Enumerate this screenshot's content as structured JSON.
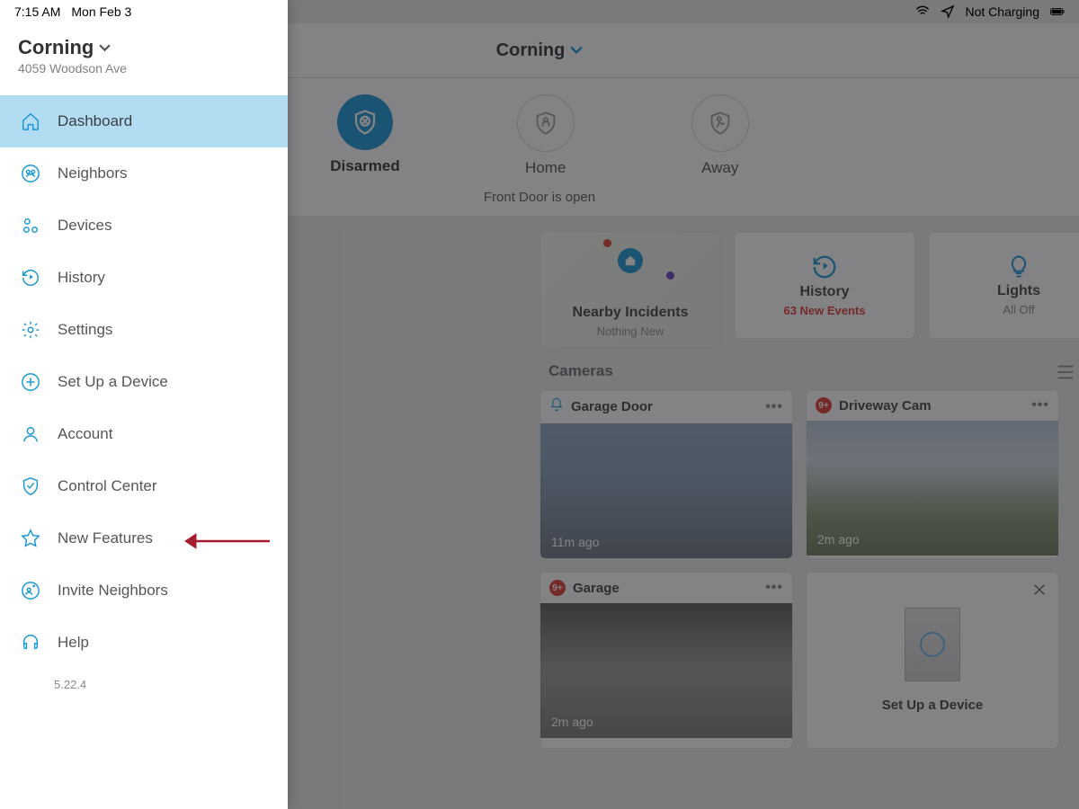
{
  "statusbar": {
    "time": "7:15 AM",
    "date": "Mon Feb 3",
    "charge": "Not Charging"
  },
  "sidebar": {
    "location": "Corning",
    "address": "4059 Woodson Ave",
    "items": [
      {
        "label": "Dashboard",
        "icon": "home-icon"
      },
      {
        "label": "Neighbors",
        "icon": "group-icon"
      },
      {
        "label": "Devices",
        "icon": "devices-icon"
      },
      {
        "label": "History",
        "icon": "history-icon"
      },
      {
        "label": "Settings",
        "icon": "gear-icon"
      },
      {
        "label": "Set Up a Device",
        "icon": "plus-circle-icon"
      },
      {
        "label": "Account",
        "icon": "user-icon"
      },
      {
        "label": "Control Center",
        "icon": "shield-check-icon"
      },
      {
        "label": "New Features",
        "icon": "star-icon"
      },
      {
        "label": "Invite Neighbors",
        "icon": "invite-icon"
      },
      {
        "label": "Help",
        "icon": "headset-icon"
      }
    ],
    "version": "5.22.4"
  },
  "header": {
    "location": "Corning"
  },
  "alarm": {
    "modes": [
      {
        "label": "Disarmed",
        "icon": "disarmed-icon",
        "active": true
      },
      {
        "label": "Home",
        "icon": "home-mode-icon",
        "active": false
      },
      {
        "label": "Away",
        "icon": "away-mode-icon",
        "active": false
      }
    ],
    "status": "Front Door is open"
  },
  "widgets": [
    {
      "title": "Nearby Incidents",
      "sub": "Nothing New",
      "type": "map"
    },
    {
      "title": "History",
      "sub": "63 New Events",
      "type": "history",
      "red": true
    },
    {
      "title": "Lights",
      "sub": "All Off",
      "type": "lights"
    }
  ],
  "cameras": {
    "section": "Cameras",
    "items": [
      {
        "name": "Garage Door",
        "ago": "11m ago",
        "badge": "bell"
      },
      {
        "name": "Driveway Cam",
        "ago": "2m ago",
        "badge": "9+"
      },
      {
        "name": "Garage",
        "ago": "2m ago",
        "badge": "9+"
      }
    ],
    "setup": "Set Up a Device"
  },
  "colors": {
    "ring_blue": "#1998d5",
    "alert_red": "#e03b36"
  }
}
